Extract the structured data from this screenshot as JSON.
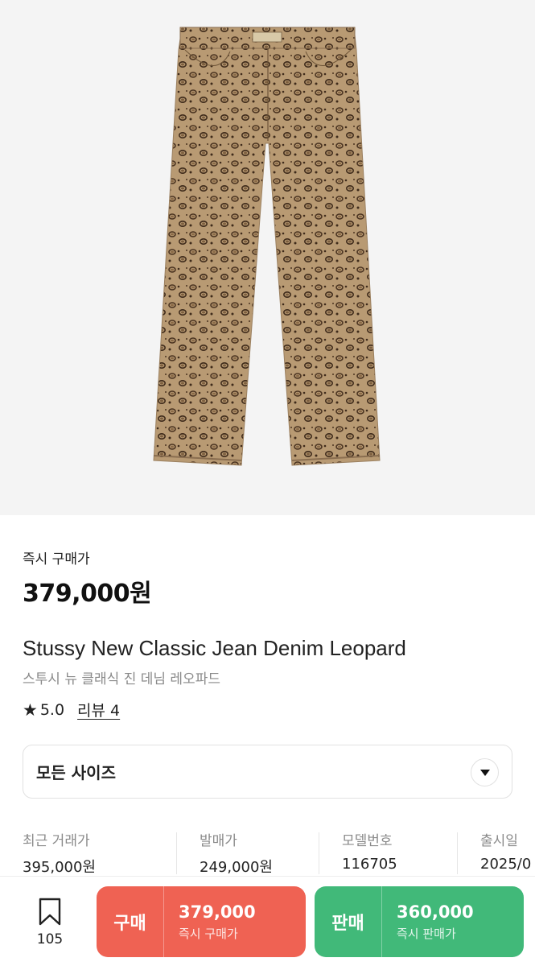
{
  "product": {
    "image_alt": "leopard-print-jeans",
    "price_label": "즉시 구매가",
    "price": "379,000원",
    "title_en": "Stussy New Classic Jean Denim Leopard",
    "title_ko": "스투시 뉴 클래식 진 데님 레오파드",
    "rating": "5.0",
    "review_label": "리뷰 4"
  },
  "size_select": {
    "label": "모든 사이즈",
    "icon": "chevron-down-icon"
  },
  "stats": [
    {
      "label": "최근 거래가",
      "value": "395,000원"
    },
    {
      "label": "발매가",
      "value": "249,000원"
    },
    {
      "label": "모델번호",
      "value": "116705"
    },
    {
      "label": "출시일",
      "value": "2025/0"
    }
  ],
  "bottom_bar": {
    "bookmark_count": "105",
    "buy": {
      "tag": "구매",
      "price": "379,000",
      "sub": "즉시 구매가",
      "color": "#ef6253"
    },
    "sell": {
      "tag": "판매",
      "price": "360,000",
      "sub": "즉시 판매가",
      "color": "#41b979"
    }
  }
}
